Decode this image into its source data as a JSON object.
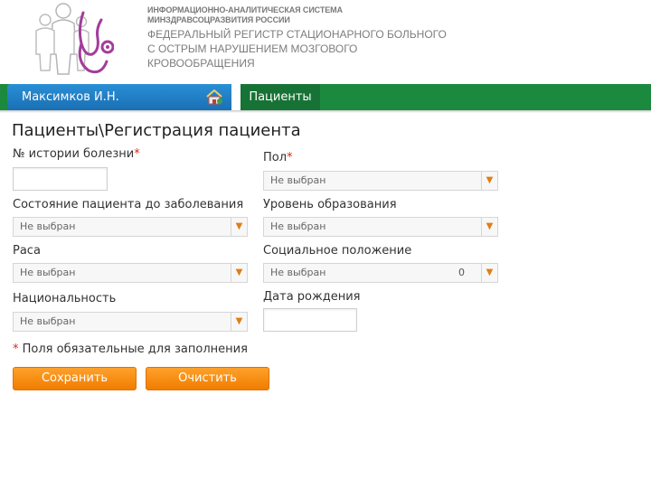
{
  "header": {
    "system_line1": "ИНФОРМАЦИОННО-АНАЛИТИЧЕСКАЯ СИСТЕМА",
    "system_line2": "МИНЗДРАВСОЦРАЗВИТИЯ РОССИИ",
    "registry_line1": "ФЕДЕРАЛЬНЫЙ РЕГИСТР СТАЦИОНАРНОГО БОЛЬНОГО",
    "registry_line2": "С ОСТРЫМ НАРУШЕНИЕМ МОЗГОВОГО",
    "registry_line3": "КРОВООБРАЩЕНИЯ",
    "logo_icon": "family-stethoscope-logo"
  },
  "nav": {
    "user_name": "Максимков И.Н.",
    "home_icon": "home-icon",
    "tab_label": "Пациенты"
  },
  "page": {
    "title": "Пациенты\\Регистрация пациента"
  },
  "form": {
    "history_label": "№ истории болезни",
    "history_value": "",
    "gender_label": "Пол",
    "gender_value": "Не выбран",
    "prior_state_label": "Состояние пациента до заболевания",
    "prior_state_value": "Не выбран",
    "education_label": "Уровень образования",
    "education_value": "Не выбран",
    "race_label": "Раса",
    "race_value": "Не выбран",
    "social_label": "Социальное положение",
    "social_value": "Не выбран",
    "social_extra": "0",
    "nationality_label": "Национальность",
    "nationality_value": "Не выбран",
    "birthdate_label": "Дата рождения",
    "birthdate_value": "",
    "required_marker": "*",
    "required_note": "Поля обязательные для заполнения"
  },
  "buttons": {
    "save": "Сохранить",
    "clear": "Очистить"
  },
  "colors": {
    "nav_green": "#1b8a3f",
    "nav_blue": "#2a8fd6",
    "button_orange": "#f59000",
    "required_red": "#d9261c",
    "logo_purple": "#a23d9a"
  }
}
